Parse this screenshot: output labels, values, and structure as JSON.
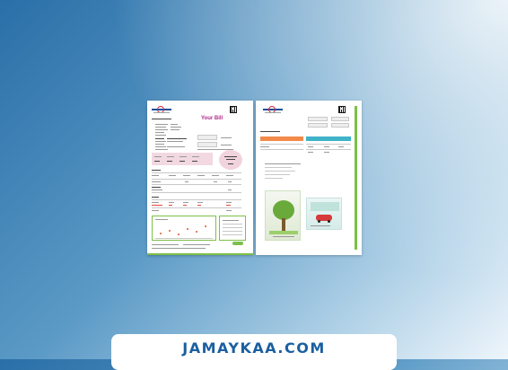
{
  "bill_left": {
    "title": "Your Bill"
  },
  "banner": {
    "text": "JAMAYKAA.COM"
  },
  "colors": {
    "accent_green": "#7cc04a",
    "title_purple": "#b02a8a",
    "banner_blue": "#1b5fa0",
    "table_orange": "#f28a4a",
    "table_teal": "#3fb3c8"
  }
}
